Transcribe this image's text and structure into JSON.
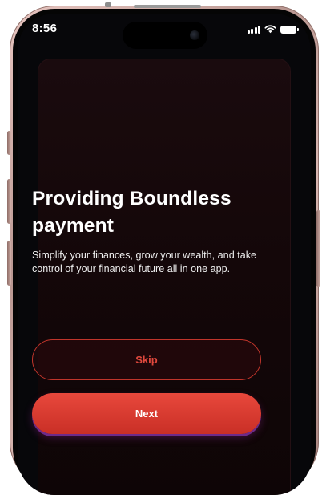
{
  "status_bar": {
    "time": "8:56",
    "icons": [
      "signal-icon",
      "wifi-icon",
      "battery-icon"
    ]
  },
  "onboarding": {
    "title": "Providing Boundless payment",
    "description": "Simplify your finances, grow your wealth, and take control of your financial future all in one app.",
    "skip_label": "Skip",
    "next_label": "Next"
  },
  "colors": {
    "accent": "#e0483d",
    "button_gradient_top": "#e8483c",
    "button_gradient_bottom": "#c92f26",
    "button_shadow": "#6e2a8a",
    "card_background": "#1a0b0e",
    "screen_background": "#07070a",
    "phone_frame": "#c9a7a0"
  }
}
